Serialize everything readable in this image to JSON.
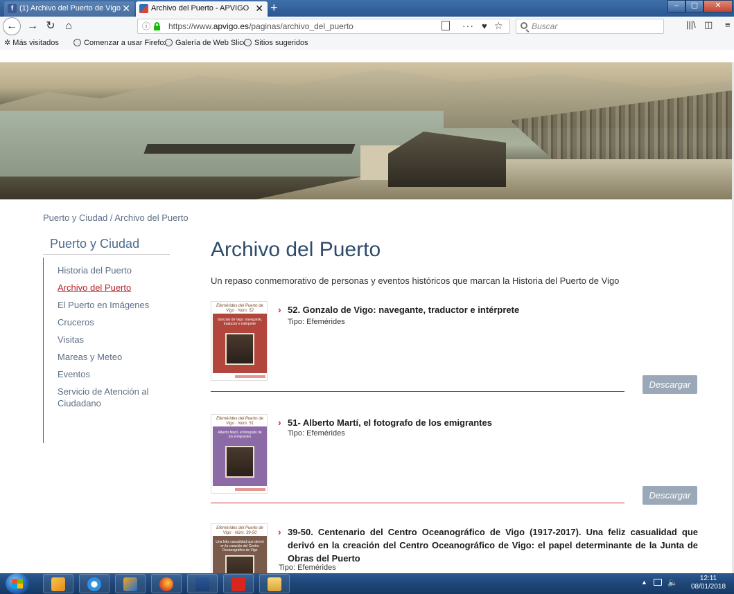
{
  "browser": {
    "tabs": [
      {
        "label": "(1) Archivo del Puerto de Vigo",
        "close": "✕"
      },
      {
        "label": "Archivo del Puerto - APVIGO",
        "close": "✕"
      }
    ],
    "new_tab": "+",
    "url_prefix": "https://www.",
    "url_domain": "apvigo.es",
    "url_path": "/paginas/archivo_del_puerto",
    "search_placeholder": "Buscar",
    "bookmarks": [
      "Más visitados",
      "Comenzar a usar Firefox",
      "Galería de Web Slice",
      "Sitios sugeridos"
    ]
  },
  "breadcrumb": "Puerto y Ciudad / Archivo del Puerto",
  "sidebar": {
    "title": "Puerto y Ciudad",
    "items": [
      {
        "label": "Historia del Puerto"
      },
      {
        "label": "Archivo del Puerto"
      },
      {
        "label": "El Puerto en Imágenes"
      },
      {
        "label": "Cruceros"
      },
      {
        "label": "Visitas"
      },
      {
        "label": "Mareas y Meteo"
      },
      {
        "label": "Eventos"
      },
      {
        "label": "Servicio de Atención al Ciudadano"
      }
    ]
  },
  "page": {
    "title": "Archivo del Puerto",
    "description": "Un repaso conmemorativo de personas y eventos históricos que marcan la Historia del Puerto de Vigo"
  },
  "entries": [
    {
      "title": "52. Gonzalo de Vigo: navegante, traductor e intérprete",
      "type": "Tipo: Efemérides",
      "button": "Descargar",
      "thumb_header": "Efemérides del Puerto de Vigo · Núm. 52",
      "thumb_text": "Gonzalo de Vigo: navegante, traductor e intérprete",
      "thumb_color": "#b3463c"
    },
    {
      "title": "51- Alberto Martí, el fotografo de los emigrantes",
      "type": "Tipo: Efemérides",
      "button": "Descargar",
      "thumb_header": "Efemérides del Puerto de Vigo · Núm. 51",
      "thumb_text": "Alberto Martí, el fotografo de los emigrantes",
      "thumb_color": "#8b6aa6"
    },
    {
      "title": "39-50. Centenario del Centro Oceanográfico de Vigo (1917-2017). Una feliz casualidad que derivó en la creación del Centro Oceanográfico de Vigo: el papel determinante de la Junta de Obras del Puerto",
      "type": "Tipo: Efemérides",
      "thumb_header": "Efemérides del Puerto de Vigo · Núm. 39-50",
      "thumb_text": "Una feliz casualidad que derivó en la creación del Centro Oceanográfico de Vigo",
      "thumb_color": "#7a5a4a"
    }
  ],
  "taskbar": {
    "time": "12:11",
    "date": "08/01/2018"
  },
  "colors": {
    "accent": "#c9302c",
    "heading": "#2e4b6c",
    "link": "#5d6f84",
    "button": "#9aa8b8"
  }
}
